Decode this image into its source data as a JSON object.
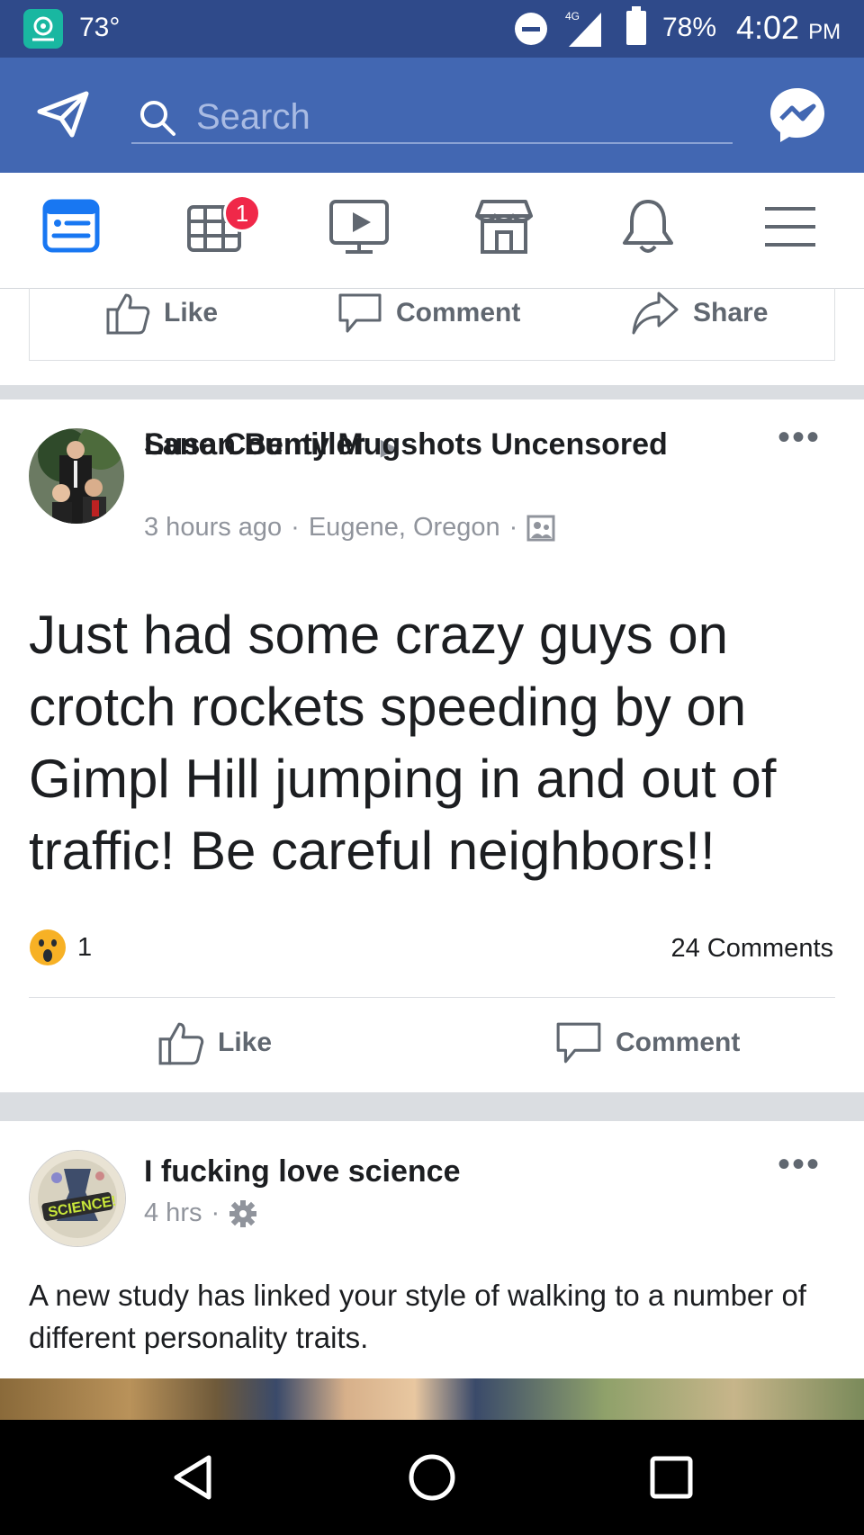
{
  "status_bar": {
    "temperature": "73°",
    "network": "4G",
    "battery": "78%",
    "time": "4:02",
    "ampm": "PM"
  },
  "top_bar": {
    "search_placeholder": "Search"
  },
  "nav": {
    "notifications_badge": "1"
  },
  "previous_post_actions": {
    "like": "Like",
    "comment": "Comment",
    "share": "Share"
  },
  "post1": {
    "author": "Susan Bemiller",
    "group": "Lane County Mugshots Uncensored",
    "time": "3 hours ago",
    "location": "Eugene, Oregon",
    "text": "Just had some crazy guys on crotch rockets speeding by on Gimpl Hill jumping in and out of traffic! Be careful neighbors!!",
    "reaction_count": "1",
    "comments_count": "24 Comments",
    "like_label": "Like",
    "comment_label": "Comment"
  },
  "post2": {
    "author": "I fucking love science",
    "time": "4 hrs",
    "text": "A new study has linked your style of walking to a number of different personality traits.",
    "logo_text": "SCIENCE!"
  },
  "colors": {
    "facebook_blue": "#4267b2",
    "status_bar": "#2f4a8a",
    "badge_red": "#f02849"
  }
}
